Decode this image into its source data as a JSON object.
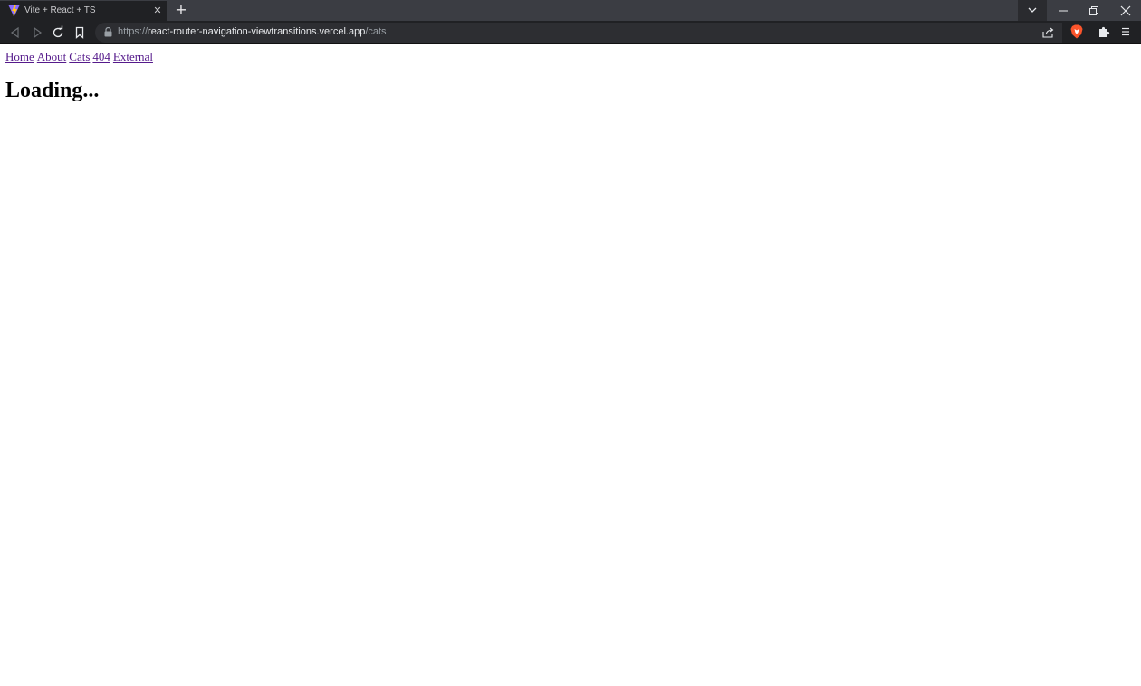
{
  "browser": {
    "tab": {
      "title": "Vite + React + TS",
      "favicon": "vite-logo-icon",
      "close_glyph": "✕"
    },
    "new_tab_glyph": "+",
    "toolbar": {
      "back_icon": "back-arrow-icon",
      "forward_icon": "forward-arrow-icon",
      "reload_icon": "reload-icon",
      "bookmark_icon": "bookmark-icon",
      "url_scheme": "https://",
      "url_host": "react-router-navigation-viewtransitions.vercel.app",
      "url_path": "/cats",
      "share_icon": "share-icon",
      "brave_shield_icon": "brave-shield-icon",
      "extensions_icon": "puzzle-icon",
      "menu_icon": "hamburger-menu-icon"
    },
    "window_controls": [
      "tab-search-chevron-icon",
      "minimize-icon",
      "restore-icon",
      "close-icon"
    ]
  },
  "page": {
    "nav": {
      "links": [
        "Home",
        "About",
        "Cats",
        "404",
        "External"
      ]
    },
    "heading": "Loading..."
  },
  "colors": {
    "tab_strip": "#3b3d43",
    "toolbar": "#202124",
    "link_visited": "#551a8b",
    "brave_orange": "#fb542b"
  }
}
